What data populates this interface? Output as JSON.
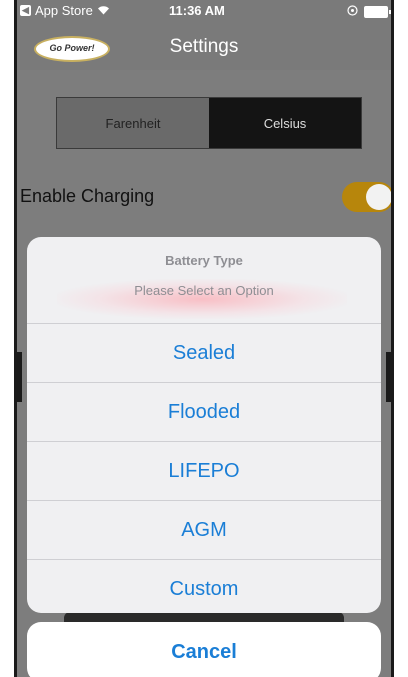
{
  "status_bar": {
    "back_app": "App Store",
    "time": "11:36 AM"
  },
  "nav": {
    "logo_text": "Go Power!",
    "title": "Settings"
  },
  "temperature_unit": {
    "options": [
      "Farenheit",
      "Celsius"
    ],
    "selected": "Celsius"
  },
  "enable_charging": {
    "label": "Enable Charging",
    "on": true
  },
  "action_sheet": {
    "title": "Battery Type",
    "message": "Please Select an Option",
    "options": [
      "Sealed",
      "Flooded",
      "LIFEPO",
      "AGM",
      "Custom"
    ],
    "cancel_label": "Cancel"
  },
  "colors": {
    "accent_blue": "#1a7ed6",
    "toggle_on": "#b7860c"
  }
}
